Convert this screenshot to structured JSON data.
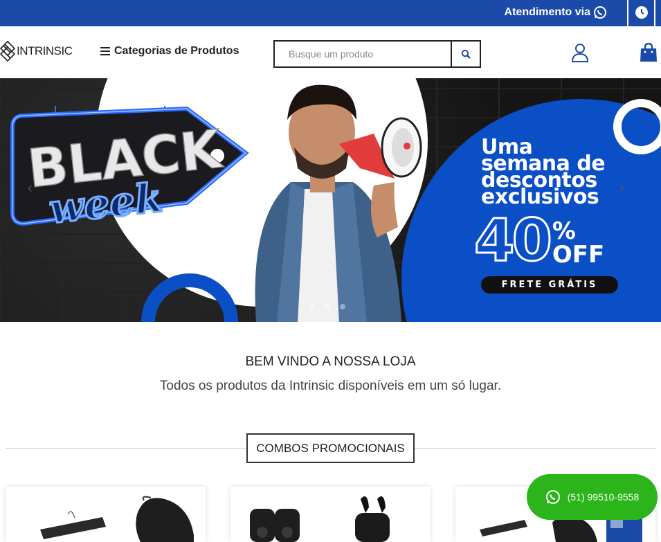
{
  "topbar": {
    "attendance_label": "Atendimento via"
  },
  "header": {
    "logo_text": "INTRINSIC",
    "categories_label": "Categorias de Produtos",
    "search_placeholder": "Busque um produto"
  },
  "banner": {
    "sign_line1": "BLACK",
    "sign_line2": "week",
    "promo_lines": [
      "Uma",
      "semana de",
      "descontos",
      "exclusivos"
    ],
    "discount_number": "40",
    "discount_percent": "%",
    "discount_off": "OFF",
    "shipping_label": "FRETE GRÁTIS",
    "slide_count": 3,
    "active_slide": 1
  },
  "welcome": {
    "title": "BEM VINDO A NOSSA LOJA",
    "subtitle": "Todos os produtos da Intrinsic disponíveis em um só lugar."
  },
  "section": {
    "title": "COMBOS PROMOCIONAIS"
  },
  "whatsapp": {
    "phone": "(51) 99510-9558"
  },
  "colors": {
    "brand_blue": "#1c4aa8",
    "banner_blue": "#0a4fc6",
    "whatsapp_green": "#2bb51a"
  }
}
